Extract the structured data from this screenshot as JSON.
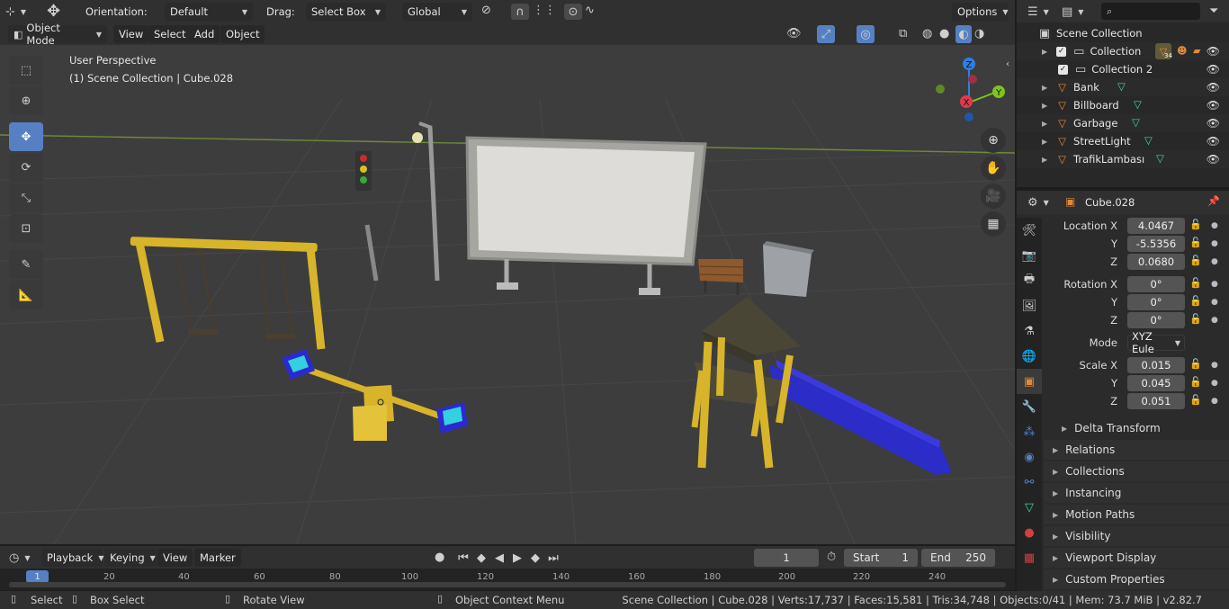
{
  "header": {
    "orientation_label": "Orientation:",
    "orientation_value": "Default",
    "drag_label": "Drag:",
    "drag_value": "Select Box",
    "transform_space": "Global",
    "options_label": "Options"
  },
  "modebar": {
    "mode": "Object Mode",
    "menu": [
      "View",
      "Select",
      "Add",
      "Object"
    ]
  },
  "viewport": {
    "perspective": "User Perspective",
    "context": "(1) Scene Collection | Cube.028",
    "gizmo": {
      "x": "X",
      "y": "Y",
      "z": "Z"
    }
  },
  "timeline": {
    "menu": [
      "Playback",
      "Keying",
      "View",
      "Marker"
    ],
    "current_frame": "1",
    "start_label": "Start",
    "start_value": "1",
    "end_label": "End",
    "end_value": "250",
    "ticks": [
      "1",
      "20",
      "40",
      "60",
      "80",
      "100",
      "120",
      "140",
      "160",
      "180",
      "200",
      "220",
      "240"
    ]
  },
  "status": {
    "select": "Select",
    "box_select": "Box Select",
    "rotate_view": "Rotate View",
    "context_menu": "Object Context Menu",
    "stats": "Scene Collection | Cube.028 | Verts:17,737 | Faces:15,581 | Tris:34,748 | Objects:0/41 | Mem: 73.7 MiB | v2.82.7"
  },
  "outliner": {
    "root": "Scene Collection",
    "items": [
      {
        "name": "Collection",
        "type": "collection",
        "badge": "34"
      },
      {
        "name": "Collection 2",
        "type": "collection"
      },
      {
        "name": "Bank",
        "type": "object"
      },
      {
        "name": "Billboard",
        "type": "object"
      },
      {
        "name": "Garbage",
        "type": "object"
      },
      {
        "name": "StreetLight",
        "type": "object"
      },
      {
        "name": "TrafikLambası",
        "type": "object"
      }
    ]
  },
  "properties": {
    "object_name": "Cube.028",
    "location": {
      "label": "Location X",
      "x": "4.0467",
      "y": "-5.5356",
      "z": "0.0680"
    },
    "rotation": {
      "label": "Rotation X",
      "x": "0°",
      "y": "0°",
      "z": "0°"
    },
    "mode_label": "Mode",
    "mode_value": "XYZ Eule",
    "scale": {
      "label": "Scale X",
      "x": "0.015",
      "y": "0.045",
      "z": "0.051"
    },
    "axis_y": "Y",
    "axis_z": "Z",
    "delta_transform": "Delta Transform",
    "panels": [
      "Relations",
      "Collections",
      "Instancing",
      "Motion Paths",
      "Visibility",
      "Viewport Display",
      "Custom Properties"
    ]
  },
  "colors": {
    "accent": "#5680c2",
    "object_orange": "#e0893a",
    "mesh_green": "#3fd3a0",
    "axis_x": "#e13a4a",
    "axis_y": "#7ec41d",
    "axis_z": "#2e7fe0"
  }
}
